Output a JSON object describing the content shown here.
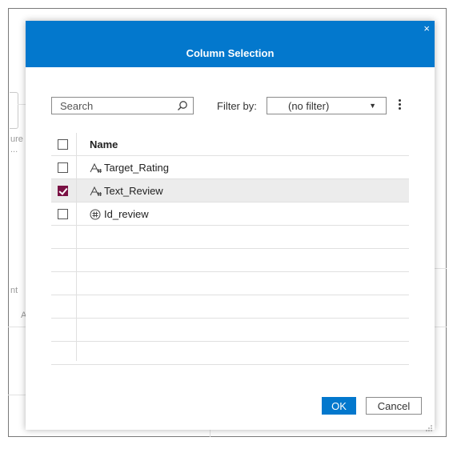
{
  "background": {
    "fragments": [
      "ure",
      "...",
      "nt",
      "A"
    ]
  },
  "dialog": {
    "title": "Column Selection",
    "close_label": "×",
    "search": {
      "placeholder": "Search",
      "value": ""
    },
    "filter": {
      "label": "Filter by:",
      "value": "(no filter)",
      "arrow": "▼"
    },
    "table": {
      "header": "Name",
      "rows": [
        {
          "name": "Target_Rating",
          "type_icon": "character-column-icon",
          "checked": false
        },
        {
          "name": "Text_Review",
          "type_icon": "character-column-icon",
          "checked": true
        },
        {
          "name": "Id_review",
          "type_icon": "numeric-column-icon",
          "checked": false
        }
      ]
    },
    "buttons": {
      "ok": "OK",
      "cancel": "Cancel"
    }
  },
  "colors": {
    "header": "#0378cd",
    "checkbox_checked": "#7a1144",
    "selected_row": "#ececec"
  }
}
